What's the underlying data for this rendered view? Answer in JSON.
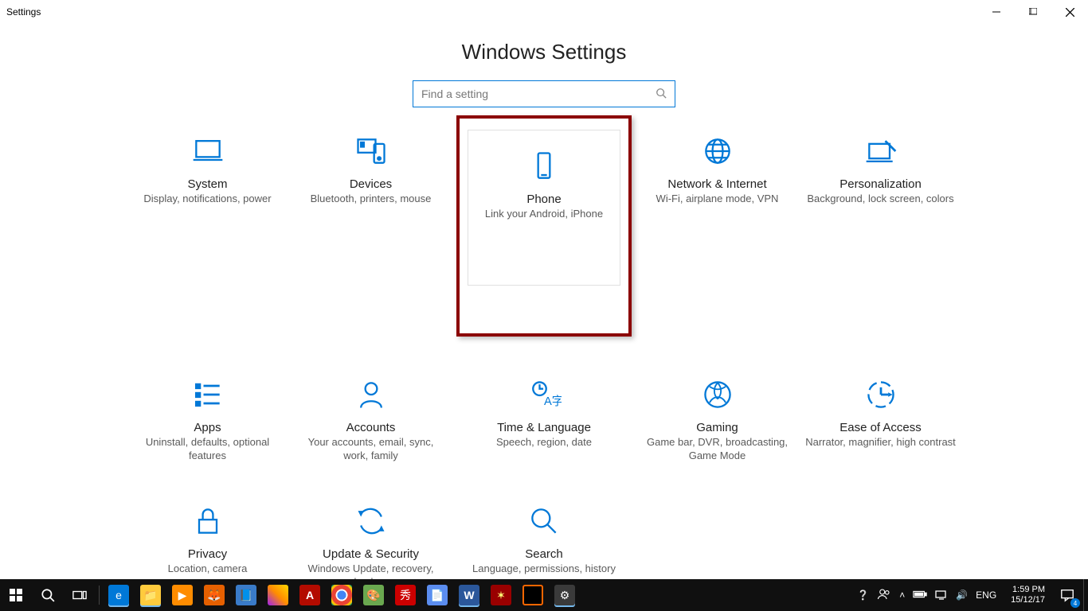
{
  "window": {
    "app_title": "Settings"
  },
  "page": {
    "title": "Windows Settings"
  },
  "search": {
    "placeholder": "Find a setting"
  },
  "tiles": {
    "system": {
      "title": "System",
      "desc": "Display, notifications, power"
    },
    "devices": {
      "title": "Devices",
      "desc": "Bluetooth, printers, mouse"
    },
    "phone": {
      "title": "Phone",
      "desc": "Link your Android, iPhone"
    },
    "network": {
      "title": "Network & Internet",
      "desc": "Wi-Fi, airplane mode, VPN"
    },
    "personalization": {
      "title": "Personalization",
      "desc": "Background, lock screen, colors"
    },
    "apps": {
      "title": "Apps",
      "desc": "Uninstall, defaults, optional features"
    },
    "accounts": {
      "title": "Accounts",
      "desc": "Your accounts, email, sync, work, family"
    },
    "time": {
      "title": "Time & Language",
      "desc": "Speech, region, date"
    },
    "gaming": {
      "title": "Gaming",
      "desc": "Game bar, DVR, broadcasting, Game Mode"
    },
    "ease": {
      "title": "Ease of Access",
      "desc": "Narrator, magnifier, high contrast"
    },
    "privacy": {
      "title": "Privacy",
      "desc": "Location, camera"
    },
    "update": {
      "title": "Update & Security",
      "desc": "Windows Update, recovery, backup"
    },
    "searchcat": {
      "title": "Search",
      "desc": "Language, permissions, history"
    }
  },
  "taskbar": {
    "lang": "ENG",
    "time": "1:59 PM",
    "date": "15/12/17",
    "notif_badge": "4"
  }
}
